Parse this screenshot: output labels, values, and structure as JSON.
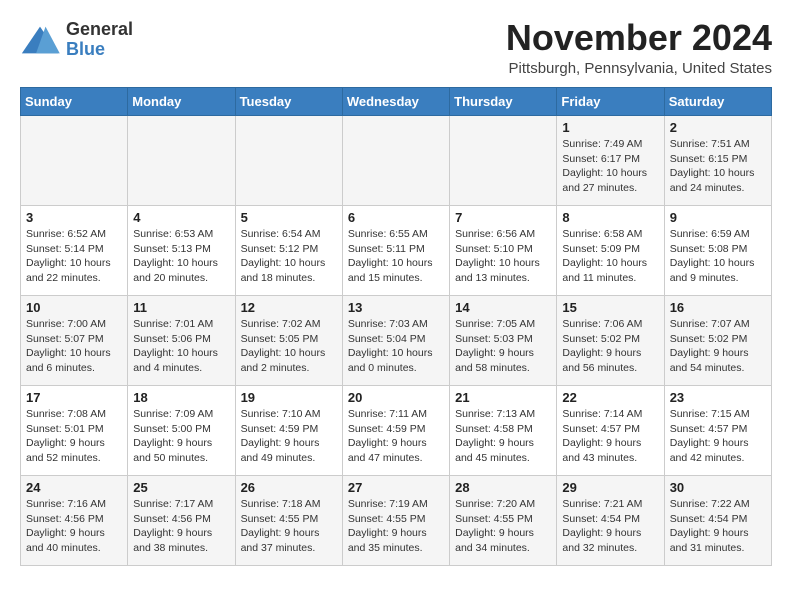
{
  "header": {
    "logo": {
      "general": "General",
      "blue": "Blue"
    },
    "title": "November 2024",
    "location": "Pittsburgh, Pennsylvania, United States"
  },
  "days_of_week": [
    "Sunday",
    "Monday",
    "Tuesday",
    "Wednesday",
    "Thursday",
    "Friday",
    "Saturday"
  ],
  "weeks": [
    [
      {
        "day": "",
        "sunrise": "",
        "sunset": "",
        "daylight": ""
      },
      {
        "day": "",
        "sunrise": "",
        "sunset": "",
        "daylight": ""
      },
      {
        "day": "",
        "sunrise": "",
        "sunset": "",
        "daylight": ""
      },
      {
        "day": "",
        "sunrise": "",
        "sunset": "",
        "daylight": ""
      },
      {
        "day": "",
        "sunrise": "",
        "sunset": "",
        "daylight": ""
      },
      {
        "day": "1",
        "sunrise": "Sunrise: 7:49 AM",
        "sunset": "Sunset: 6:17 PM",
        "daylight": "Daylight: 10 hours and 27 minutes."
      },
      {
        "day": "2",
        "sunrise": "Sunrise: 7:51 AM",
        "sunset": "Sunset: 6:15 PM",
        "daylight": "Daylight: 10 hours and 24 minutes."
      }
    ],
    [
      {
        "day": "3",
        "sunrise": "Sunrise: 6:52 AM",
        "sunset": "Sunset: 5:14 PM",
        "daylight": "Daylight: 10 hours and 22 minutes."
      },
      {
        "day": "4",
        "sunrise": "Sunrise: 6:53 AM",
        "sunset": "Sunset: 5:13 PM",
        "daylight": "Daylight: 10 hours and 20 minutes."
      },
      {
        "day": "5",
        "sunrise": "Sunrise: 6:54 AM",
        "sunset": "Sunset: 5:12 PM",
        "daylight": "Daylight: 10 hours and 18 minutes."
      },
      {
        "day": "6",
        "sunrise": "Sunrise: 6:55 AM",
        "sunset": "Sunset: 5:11 PM",
        "daylight": "Daylight: 10 hours and 15 minutes."
      },
      {
        "day": "7",
        "sunrise": "Sunrise: 6:56 AM",
        "sunset": "Sunset: 5:10 PM",
        "daylight": "Daylight: 10 hours and 13 minutes."
      },
      {
        "day": "8",
        "sunrise": "Sunrise: 6:58 AM",
        "sunset": "Sunset: 5:09 PM",
        "daylight": "Daylight: 10 hours and 11 minutes."
      },
      {
        "day": "9",
        "sunrise": "Sunrise: 6:59 AM",
        "sunset": "Sunset: 5:08 PM",
        "daylight": "Daylight: 10 hours and 9 minutes."
      }
    ],
    [
      {
        "day": "10",
        "sunrise": "Sunrise: 7:00 AM",
        "sunset": "Sunset: 5:07 PM",
        "daylight": "Daylight: 10 hours and 6 minutes."
      },
      {
        "day": "11",
        "sunrise": "Sunrise: 7:01 AM",
        "sunset": "Sunset: 5:06 PM",
        "daylight": "Daylight: 10 hours and 4 minutes."
      },
      {
        "day": "12",
        "sunrise": "Sunrise: 7:02 AM",
        "sunset": "Sunset: 5:05 PM",
        "daylight": "Daylight: 10 hours and 2 minutes."
      },
      {
        "day": "13",
        "sunrise": "Sunrise: 7:03 AM",
        "sunset": "Sunset: 5:04 PM",
        "daylight": "Daylight: 10 hours and 0 minutes."
      },
      {
        "day": "14",
        "sunrise": "Sunrise: 7:05 AM",
        "sunset": "Sunset: 5:03 PM",
        "daylight": "Daylight: 9 hours and 58 minutes."
      },
      {
        "day": "15",
        "sunrise": "Sunrise: 7:06 AM",
        "sunset": "Sunset: 5:02 PM",
        "daylight": "Daylight: 9 hours and 56 minutes."
      },
      {
        "day": "16",
        "sunrise": "Sunrise: 7:07 AM",
        "sunset": "Sunset: 5:02 PM",
        "daylight": "Daylight: 9 hours and 54 minutes."
      }
    ],
    [
      {
        "day": "17",
        "sunrise": "Sunrise: 7:08 AM",
        "sunset": "Sunset: 5:01 PM",
        "daylight": "Daylight: 9 hours and 52 minutes."
      },
      {
        "day": "18",
        "sunrise": "Sunrise: 7:09 AM",
        "sunset": "Sunset: 5:00 PM",
        "daylight": "Daylight: 9 hours and 50 minutes."
      },
      {
        "day": "19",
        "sunrise": "Sunrise: 7:10 AM",
        "sunset": "Sunset: 4:59 PM",
        "daylight": "Daylight: 9 hours and 49 minutes."
      },
      {
        "day": "20",
        "sunrise": "Sunrise: 7:11 AM",
        "sunset": "Sunset: 4:59 PM",
        "daylight": "Daylight: 9 hours and 47 minutes."
      },
      {
        "day": "21",
        "sunrise": "Sunrise: 7:13 AM",
        "sunset": "Sunset: 4:58 PM",
        "daylight": "Daylight: 9 hours and 45 minutes."
      },
      {
        "day": "22",
        "sunrise": "Sunrise: 7:14 AM",
        "sunset": "Sunset: 4:57 PM",
        "daylight": "Daylight: 9 hours and 43 minutes."
      },
      {
        "day": "23",
        "sunrise": "Sunrise: 7:15 AM",
        "sunset": "Sunset: 4:57 PM",
        "daylight": "Daylight: 9 hours and 42 minutes."
      }
    ],
    [
      {
        "day": "24",
        "sunrise": "Sunrise: 7:16 AM",
        "sunset": "Sunset: 4:56 PM",
        "daylight": "Daylight: 9 hours and 40 minutes."
      },
      {
        "day": "25",
        "sunrise": "Sunrise: 7:17 AM",
        "sunset": "Sunset: 4:56 PM",
        "daylight": "Daylight: 9 hours and 38 minutes."
      },
      {
        "day": "26",
        "sunrise": "Sunrise: 7:18 AM",
        "sunset": "Sunset: 4:55 PM",
        "daylight": "Daylight: 9 hours and 37 minutes."
      },
      {
        "day": "27",
        "sunrise": "Sunrise: 7:19 AM",
        "sunset": "Sunset: 4:55 PM",
        "daylight": "Daylight: 9 hours and 35 minutes."
      },
      {
        "day": "28",
        "sunrise": "Sunrise: 7:20 AM",
        "sunset": "Sunset: 4:55 PM",
        "daylight": "Daylight: 9 hours and 34 minutes."
      },
      {
        "day": "29",
        "sunrise": "Sunrise: 7:21 AM",
        "sunset": "Sunset: 4:54 PM",
        "daylight": "Daylight: 9 hours and 32 minutes."
      },
      {
        "day": "30",
        "sunrise": "Sunrise: 7:22 AM",
        "sunset": "Sunset: 4:54 PM",
        "daylight": "Daylight: 9 hours and 31 minutes."
      }
    ]
  ]
}
